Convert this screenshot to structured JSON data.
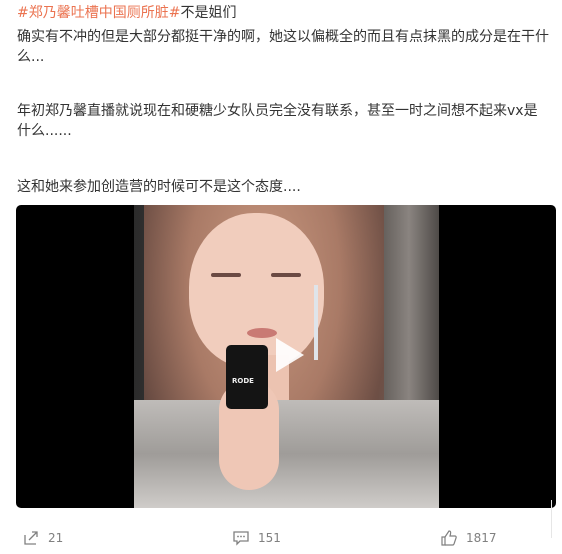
{
  "post": {
    "topic": "#郑乃馨吐槽中国厕所脏#",
    "line1_rest": "不是姐们",
    "para1": "确实有不冲的但是大部分都挺干净的啊，她这以偏概全的而且有点抹黑的成分是在干什么...",
    "para2": "年初郑乃馨直播就说现在和硬糖少女队员完全没有联系，甚至一时之间想不起来vx是什么......",
    "para3": "这和她来参加创造营的时候可不是这个态度....",
    "video": {
      "mic_label": "RODE",
      "play_icon": "play-icon"
    }
  },
  "actions": {
    "share_count": "21",
    "comment_count": "151",
    "like_count": "1817"
  },
  "colors": {
    "topic": "#eb7350",
    "text": "#333333",
    "meta": "#808080"
  }
}
